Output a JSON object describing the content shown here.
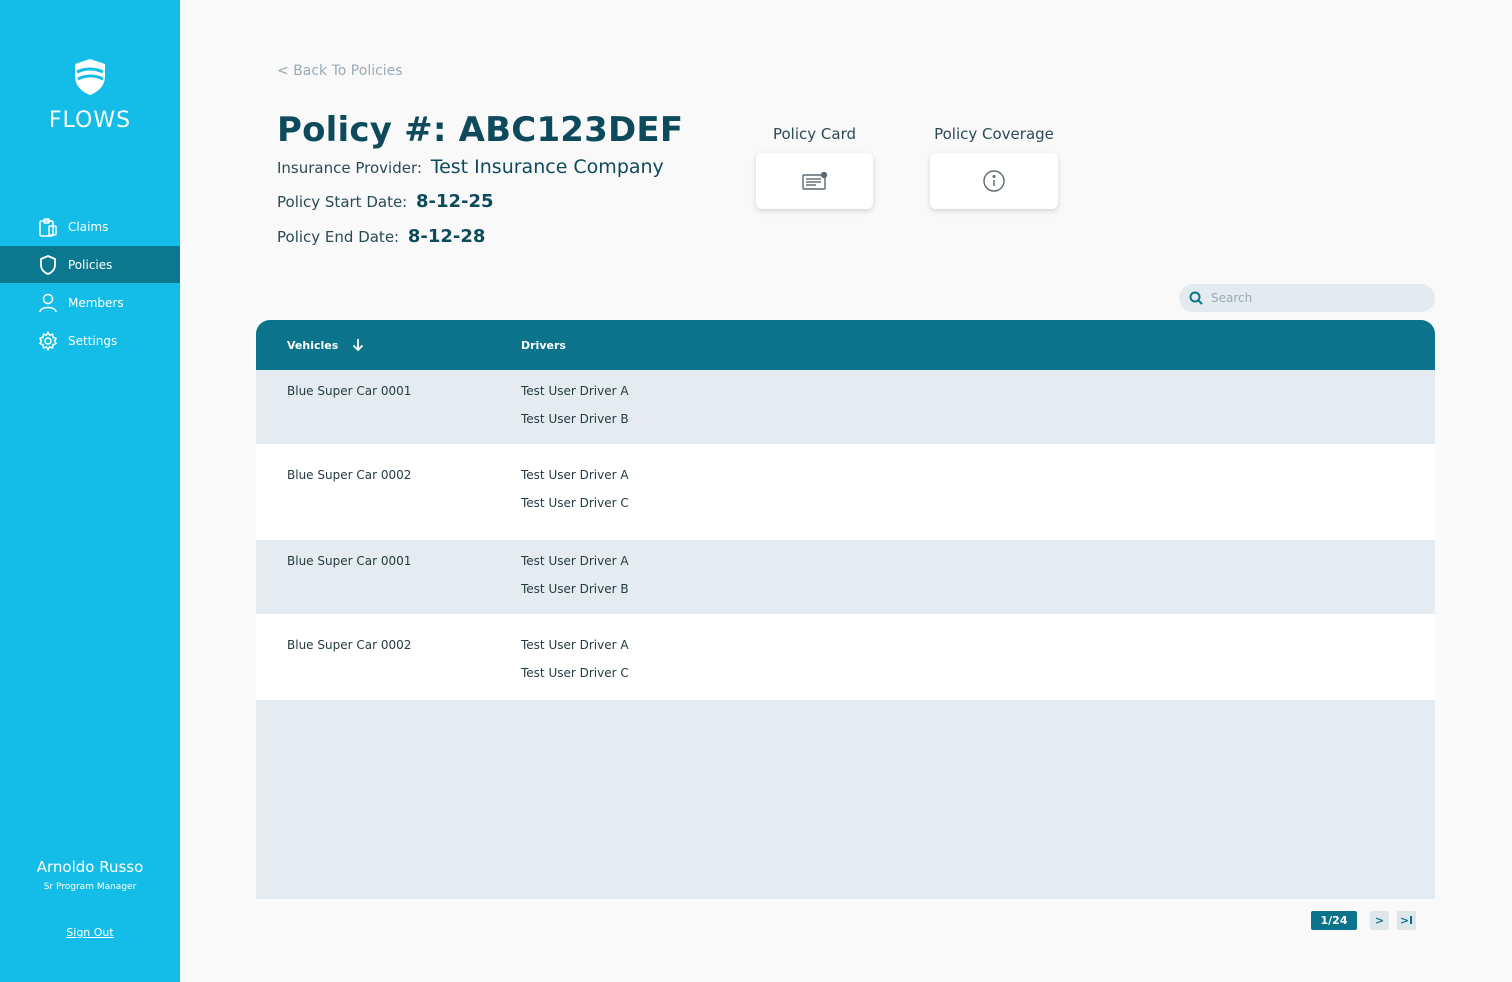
{
  "app": {
    "name": "FLOWS"
  },
  "sidebar": {
    "items": [
      {
        "label": "Claims",
        "icon": "clipboard-icon",
        "active": false
      },
      {
        "label": "Policies",
        "icon": "shield-icon",
        "active": true
      },
      {
        "label": "Members",
        "icon": "user-icon",
        "active": false
      },
      {
        "label": "Settings",
        "icon": "gear-icon",
        "active": false
      }
    ],
    "user": {
      "name": "Arnoldo Russo",
      "role": "Sr Program Manager"
    },
    "sign_out": "Sign Out"
  },
  "header": {
    "back_link": "< Back To Policies",
    "policy_title": "Policy #: ABC123DEF",
    "provider_label": "Insurance Provider:",
    "provider_value": "Test Insurance Company",
    "start_label": "Policy Start Date:",
    "start_value": "8-12-25",
    "end_label": "Policy End Date:",
    "end_value": "8-12-28"
  },
  "cards": {
    "policy_card_label": "Policy Card",
    "policy_coverage_label": "Policy Coverage"
  },
  "search": {
    "placeholder": "Search"
  },
  "table": {
    "columns": {
      "vehicles": "Vehicles",
      "drivers": "Drivers"
    },
    "rows": [
      {
        "vehicle": "Blue Super Car 0001",
        "drivers": [
          "Test User Driver A",
          "Test User Driver B"
        ]
      },
      {
        "vehicle": "Blue Super Car 0002",
        "drivers": [
          "Test User Driver A",
          "Test User Driver C"
        ]
      },
      {
        "vehicle": "Blue Super Car 0001",
        "drivers": [
          "Test User Driver A",
          "Test User Driver B"
        ]
      },
      {
        "vehicle": "Blue Super Car 0002",
        "drivers": [
          "Test User Driver A",
          "Test User Driver C"
        ]
      }
    ]
  },
  "pagination": {
    "current": "1/24",
    "next": ">",
    "last": ">I"
  },
  "colors": {
    "sidebar": "#14bde8",
    "sidebar_active": "#0b7890",
    "table_header": "#0b748c",
    "row_shade": "#e4ebf1",
    "text_dark": "#0c4a5c"
  }
}
